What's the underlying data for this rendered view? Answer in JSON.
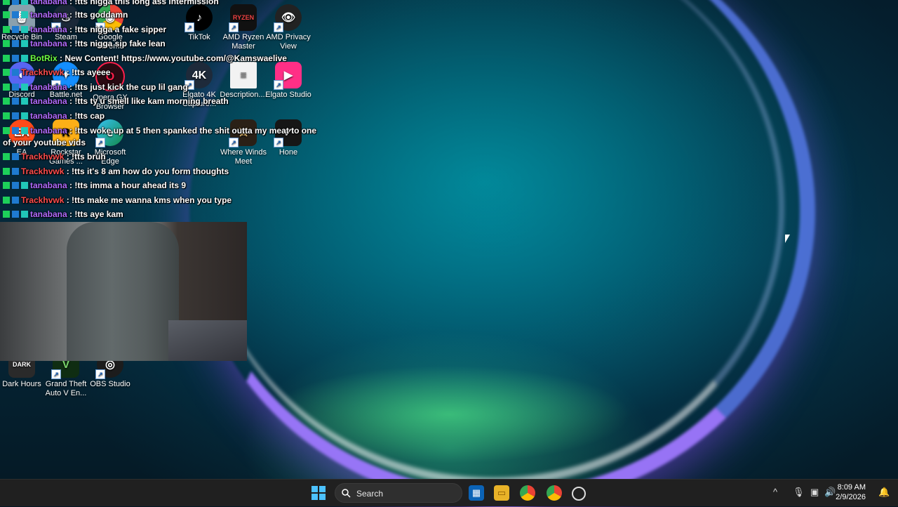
{
  "desktop": {
    "icons": [
      {
        "label": "Recycle Bin",
        "glyph": "🗑"
      },
      {
        "label": "Steam",
        "glyph": "♨"
      },
      {
        "label": "Google Chrome",
        "glyph": "◉"
      },
      {
        "label": "TikTok",
        "glyph": "♪"
      },
      {
        "label": "AMD Ryzen Master",
        "glyph": "RYZEN"
      },
      {
        "label": "AMD Privacy View",
        "glyph": "👁"
      },
      {
        "label": "Discord",
        "glyph": "◐"
      },
      {
        "label": "Battle.net",
        "glyph": "✦"
      },
      {
        "label": "Opera GX Browser",
        "glyph": "O"
      },
      {
        "label": "Elgato 4K Capture...",
        "glyph": "4K"
      },
      {
        "label": "Description....",
        "glyph": "≡"
      },
      {
        "label": "Elgato Studio",
        "glyph": "▶"
      },
      {
        "label": "EA",
        "glyph": "EA"
      },
      {
        "label": "Rockstar Games ...",
        "glyph": "R"
      },
      {
        "label": "Microsoft Edge",
        "glyph": "e"
      },
      {
        "label": "Where Winds Meet",
        "glyph": "⚔"
      },
      {
        "label": "Hone",
        "glyph": "✓"
      },
      {
        "label": "Dark Hours",
        "glyph": "DARK"
      },
      {
        "label": "Grand Theft Auto V En...",
        "glyph": "V"
      },
      {
        "label": "OBS Studio",
        "glyph": "◎"
      }
    ]
  },
  "chat": [
    {
      "user": "tanabana",
      "msg": " : !tts nigga this long ass intermission"
    },
    {
      "user": "tanabana",
      "msg": " : !tts goddamn"
    },
    {
      "user": "tanabana",
      "msg": " : !tts nigga a fake sipper"
    },
    {
      "user": "tanabana",
      "msg": " : !tts nigga sip fake lean"
    },
    {
      "user": "BotRix",
      "msg": " : New Content! https://www.youtube.com/@Kamswaelive"
    },
    {
      "user": "Trackhvwk",
      "msg": " : !tts ayeee"
    },
    {
      "user": "tanabana",
      "msg": " : !tts just kick the cup lil gang"
    },
    {
      "user": "tanabana",
      "msg": " : !tts ty u smell like kam morning breath"
    },
    {
      "user": "tanabana",
      "msg": " : !tts cap"
    },
    {
      "user": "tanabana",
      "msg": " : !tts woke up at 5 then spanked the shit outta my meat to one"
    },
    {
      "user": "",
      "msg": "of your youtube vids"
    },
    {
      "user": "Trackhvwk",
      "msg": " : !tts bruh"
    },
    {
      "user": "Trackhvwk",
      "msg": " : !tts it's 8 am how do you form thoughts"
    },
    {
      "user": "tanabana",
      "msg": " : !tts imma a hour ahead its 9"
    },
    {
      "user": "Trackhvwk",
      "msg": " : !tts make me wanna kms when you type"
    },
    {
      "user": "tanabana",
      "msg": " : !tts aye kam"
    }
  ],
  "taskbar": {
    "search_label": "Search",
    "time": "8:09 AM",
    "date": "2/9/2026"
  },
  "colors": {
    "taskbar": "#202020",
    "user_purple": "#b06cff",
    "user_red": "#ff4d4d",
    "user_green": "#6dff45"
  }
}
